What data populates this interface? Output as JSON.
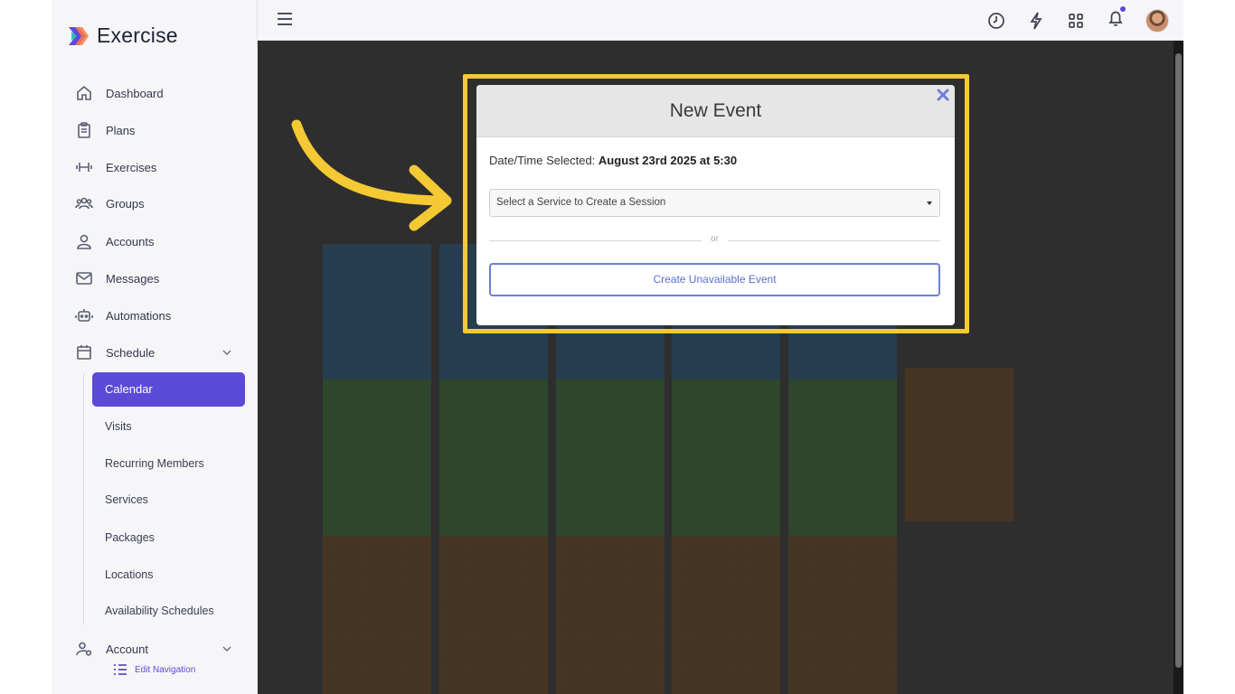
{
  "brand": {
    "name": "Exercise"
  },
  "sidebar": {
    "items": [
      {
        "label": "Dashboard",
        "icon": "home-icon"
      },
      {
        "label": "Plans",
        "icon": "clipboard-icon"
      },
      {
        "label": "Exercises",
        "icon": "dumbbell-icon"
      },
      {
        "label": "Groups",
        "icon": "users-icon"
      },
      {
        "label": "Accounts",
        "icon": "user-icon"
      },
      {
        "label": "Messages",
        "icon": "mail-icon"
      },
      {
        "label": "Automations",
        "icon": "robot-icon"
      },
      {
        "label": "Schedule",
        "icon": "calendar-icon"
      }
    ],
    "schedule_sub": [
      {
        "label": "Calendar",
        "active": true
      },
      {
        "label": "Visits"
      },
      {
        "label": "Recurring Members"
      },
      {
        "label": "Services"
      },
      {
        "label": "Packages"
      },
      {
        "label": "Locations"
      },
      {
        "label": "Availability Schedules"
      }
    ],
    "account_label": "Account",
    "edit_navigation": "Edit Navigation"
  },
  "topbar": {
    "icons": [
      "clock-icon",
      "lightning-icon",
      "grid-icon",
      "bell-icon"
    ]
  },
  "modal": {
    "title": "New Event",
    "datetime_label": "Date/Time Selected:",
    "datetime_value": "August 23rd 2025 at 5:30",
    "select_placeholder": "Select a Service to Create a Session",
    "or_text": "or",
    "unavailable_button": "Create Unavailable Event"
  },
  "colors": {
    "accent": "#5b4ad8",
    "highlight": "#f5c933",
    "button_border": "#6d80d8"
  }
}
